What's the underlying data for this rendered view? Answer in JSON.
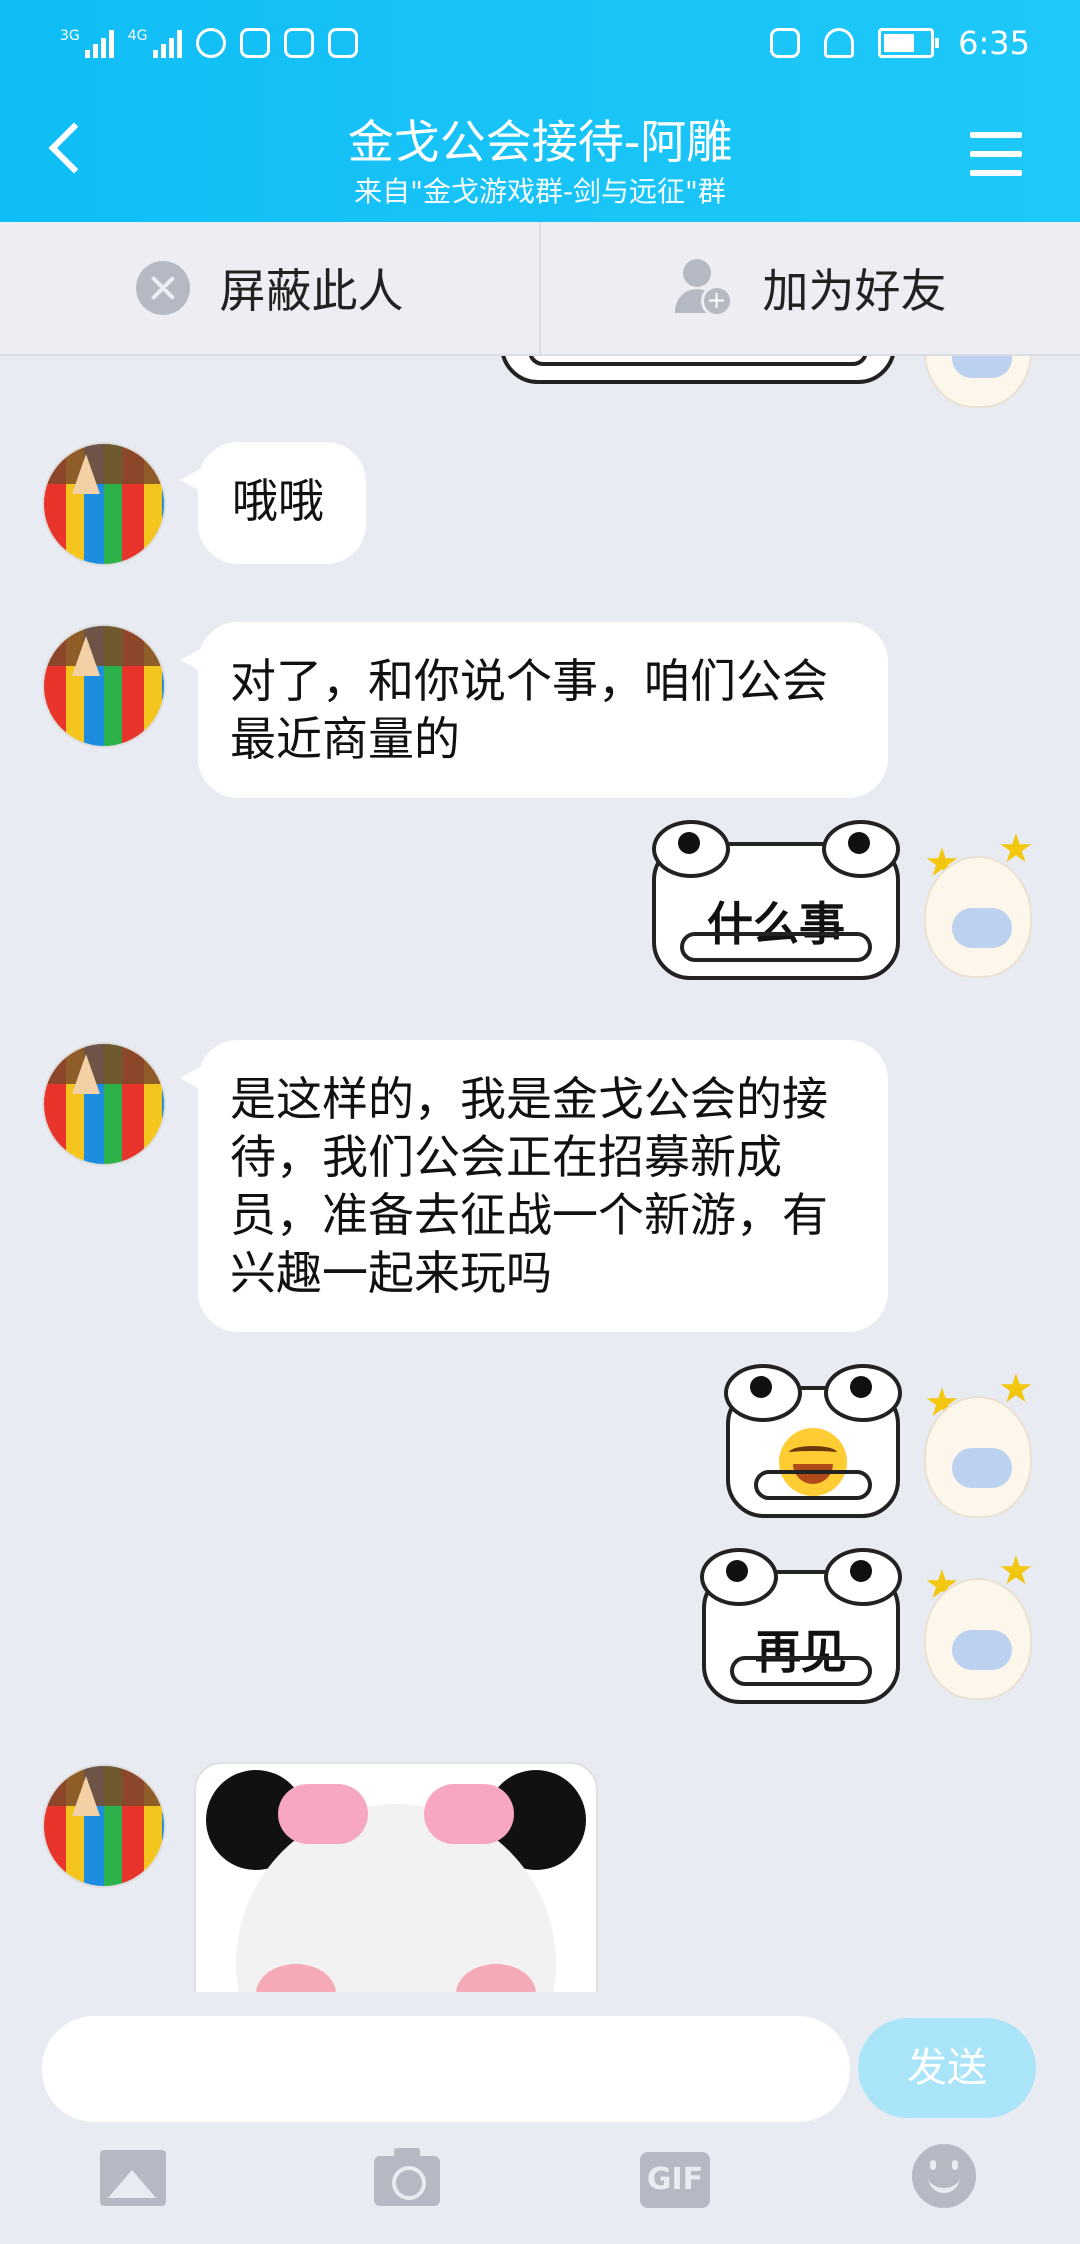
{
  "status_bar": {
    "network_left": "3G",
    "network_right": "4G",
    "time": "6:35"
  },
  "header": {
    "title": "金戈公会接待-阿雕",
    "subtitle": "来自\"金戈游戏群-剑与远征\"群",
    "back_icon": "chevron-left-icon",
    "menu_icon": "hamburger-menu-icon"
  },
  "actions": {
    "block_label": "屏蔽此人",
    "add_friend_label": "加为好友"
  },
  "messages": [
    {
      "from": "other",
      "text": "哦哦"
    },
    {
      "from": "other",
      "text": "对了，和你说个事，咱们公会最近商量的"
    },
    {
      "from": "self",
      "sticker_text": "什么事"
    },
    {
      "from": "other",
      "text": "是这样的，我是金戈公会的接待，我们公会正在招募新成员，准备去征战一个新游，有兴趣一起来玩吗"
    },
    {
      "from": "self",
      "sticker_text": ""
    },
    {
      "from": "self",
      "sticker_text": "再见"
    },
    {
      "from": "other",
      "image": "panda-meme"
    }
  ],
  "input": {
    "placeholder": "",
    "send_label": "发送"
  },
  "toolbar": {
    "gif_label": "GIF"
  },
  "colors": {
    "header": "#18c3f7",
    "background": "#e9ebf2",
    "send_button": "#a9e4f9"
  }
}
